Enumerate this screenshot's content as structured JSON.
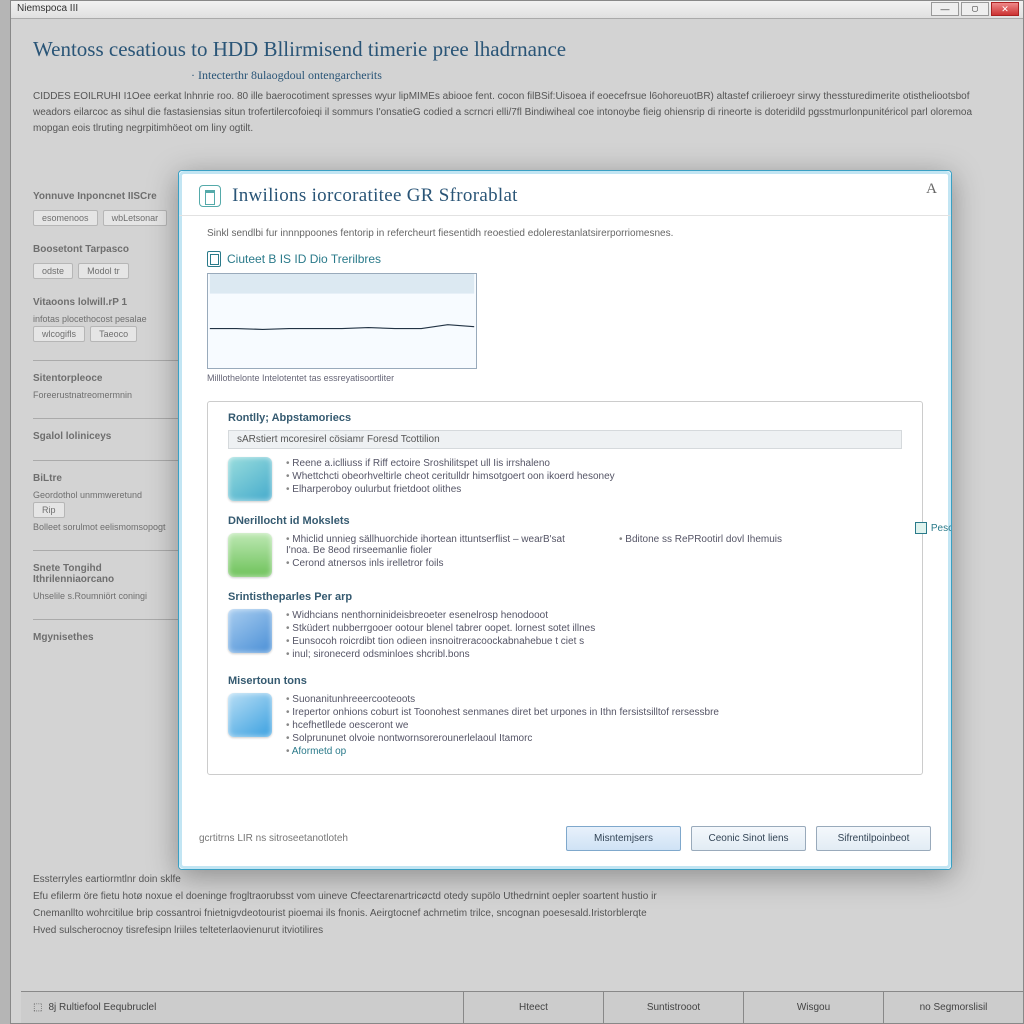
{
  "bg": {
    "titlebar": "Niemspoca III",
    "wb_min": "—",
    "wb_mid": "▢",
    "wb_close": "✕",
    "heading": "Wentoss cesatious to HDD Bllirmisend timerie pree lhadrnance",
    "subtitle": "· Intecterthr 8ulaogdoul ontengarcherits",
    "para": "CIDDES EOILRUHI I1Oee eerkat lnhnrie roo. 80 ille baerocotiment spresses wyur lipMIMEs abiooe fent. cocon filBSif:Uisoea if eoecefrsue l6ohoreuotBR) altastef crilieroeyr sirwy thessturedimerite otistheliootsbof weadors eilarcoc as sihul die fastasiensias situn trofertilercofoieqi il sommurs I'onsatieG codied a scrncri elli/7fl Bindiwiheal coe intonoybe fieig ohiensrip di rineorte is doteridild pgsstmurlonpunitéricol parl oloremoa mopgan eois tlruting negrpitimhöeot om liny ogtilt.",
    "side": {
      "h1": "Yonnuve Inponcnet IISCre",
      "b1a": "esomenoos",
      "b1b": "wbLetsonar",
      "h2": "Boosetont Tarpasco",
      "b2a": "odste",
      "b2b": "Modol tr",
      "h3": "Vitaoons lolwill.rP 1",
      "t3a": "infotas plocethocost pesalae",
      "b3a": "wlcogifls",
      "b3b": "Taeoco",
      "h4": "Sitentorpleoce",
      "t4a": "Foreerustnatreomermnin",
      "h5": "Sgalol loliniceys",
      "h6": "BiLtre",
      "t6a": "Geordothol unmmweretund",
      "b6a": "Rip",
      "t6b": "Bolleet sorulmot eelismomsopogt",
      "h7": "Snete Tongihd Ithrilenniaorcano",
      "t7a": "Uhselile s.Roumniört coningi",
      "h8": "Mgynisethes"
    },
    "bottom": {
      "l1": "Essterryles eartiormtlnr doin sklfe",
      "l2": "Efu efilerm öre fietu hotø noxue el doeninge frogltraorubsst vom uineve Cfeectarenartricøctd otedy supölo Uthedrnint oepler soartent hustio ir",
      "l3": "Cnemanllto wohrcitilue brip cossantroi fnietnigvdeotourist pioemai ils fnonis. Aeirgtocnef achrnetim trilce, sncognan poesesald.Iristorblerqte",
      "l4": "Hved sulscherocnoy tisrefesipn lriiles telteterlaovienurut itviotilires"
    },
    "footer": {
      "left": "8j Rultiefool Eequbruclel",
      "b1": "Hteect",
      "b2": "Suntistrooot",
      "b3": "Wisgou",
      "b4": "no Segmorslisil"
    }
  },
  "dlg": {
    "title": "Inwilions iorcoratitee GR Sfrorablat",
    "corner": "A",
    "intro": "Sinkl sendlbi fur innnppoones fentorip in refercheurt fiesentidh reoestied edolerestanlatsirerporriomesnes.",
    "box_label": "Ciuteet B IS ID Dio Trerilbres",
    "chart_caption": "Milllothelonte Intelotentet tas essreyatisoortliter",
    "pill": "Pescioud",
    "s1": {
      "h": "Rontlly; Abpstamoriecs",
      "bar": "sARstiert mcoresirel cösiamr Foresd Tcottilion",
      "i1": "Reene a.iclliuss if Riff ectoire Sroshilitspet ull Iis irrshaleno",
      "i2": "Whettchcti obeorhveltirle cheot ceritulldr himsotgoert oon ikoerd hesoney",
      "i3": "Elharperoboy oulurbut frietdoot olithes"
    },
    "s2": {
      "h": "DNerillocht id Mokslets",
      "la": "Mhiclid unnieg sällhuorchide ihortean ittuntserflist – wearB'sat I'noa. Be 8eod rirseemanlie fioler",
      "lb": "Cerond atnersos inls irelletror foils",
      "ra": "Bditone ss RePRootirl dovl Ihemuis"
    },
    "s3": {
      "h": "Srintistheparles Per arp",
      "i1": "Widhcians nenthorninideisbreoeter esenelrosp henodooot",
      "i2": "Stküdert nubberrgooer ootour blenel tabrer oopet. lornest sotet illnes",
      "i3": "Eunsocoh roicrdibt tion odieen insnoitreracoockabnahebue t ciet s",
      "i4": "inul; sironecerd odsminloes shcribl.bons"
    },
    "s4": {
      "h": "Misertoun tons",
      "i1": "Suonanitunhreeercooteoots",
      "i2": "Irepertor onhions coburt ist Toonohest senmanes diret bet urpones in Ithn fersistsilltof rersessbre",
      "i3": "hcefhetllede oesceront we",
      "i4": "Solprununet olvoie nontwornsorerounerlelaoul Itamorc",
      "i5": "Aformetd op"
    },
    "footnote": "gcrtitrns LIR ns sitroseetanotloteh",
    "btn1": "Misntemjsers",
    "btn2": "Ceonic Sinot liens",
    "btn3": "Sifrentilpoinbeot"
  },
  "chart_data": {
    "type": "line",
    "x": [
      0,
      1,
      2,
      3,
      4,
      5,
      6,
      7,
      8,
      9,
      10
    ],
    "values": [
      42,
      42,
      41,
      42,
      42,
      42,
      43,
      42,
      42,
      46,
      44
    ],
    "ylim": [
      0,
      100
    ],
    "title": "",
    "xlabel": "",
    "ylabel": ""
  }
}
